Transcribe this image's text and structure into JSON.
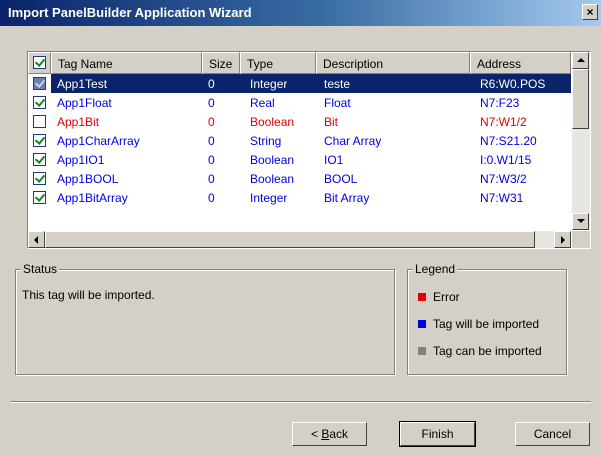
{
  "window": {
    "title": "Import PanelBuilder Application Wizard",
    "close_symbol": "×"
  },
  "table": {
    "columns": [
      "Tag Name",
      "Size",
      "Type",
      "Description",
      "Address"
    ],
    "rows": [
      {
        "checked": true,
        "name": "App1Test",
        "size": "0",
        "type": "Integer",
        "description": "teste",
        "address": "R6:W0.POS",
        "state": "selected"
      },
      {
        "checked": true,
        "name": "App1Float",
        "size": "0",
        "type": "Real",
        "description": "Float",
        "address": "N7:F23",
        "state": "import"
      },
      {
        "checked": false,
        "name": "App1Bit",
        "size": "0",
        "type": "Boolean",
        "description": "Bit",
        "address": "N7:W1/2",
        "state": "error"
      },
      {
        "checked": true,
        "name": "App1CharArray",
        "size": "0",
        "type": "String",
        "description": "Char Array",
        "address": "N7:S21.20",
        "state": "import"
      },
      {
        "checked": true,
        "name": "App1IO1",
        "size": "0",
        "type": "Boolean",
        "description": "IO1",
        "address": "I:0.W1/15",
        "state": "import"
      },
      {
        "checked": true,
        "name": "App1BOOL",
        "size": "0",
        "type": "Boolean",
        "description": "BOOL",
        "address": "N7:W3/2",
        "state": "import"
      },
      {
        "checked": true,
        "name": "App1BitArray",
        "size": "0",
        "type": "Integer",
        "description": "Bit Array",
        "address": "N7:W31",
        "state": "import"
      }
    ]
  },
  "status": {
    "label": "Status",
    "text": "This tag will be imported."
  },
  "legend": {
    "label": "Legend",
    "items": [
      {
        "text": "Error",
        "color": "#e00000"
      },
      {
        "text": "Tag will be imported",
        "color": "#0000e0"
      },
      {
        "text": "Tag can be imported",
        "color": "#808080"
      }
    ]
  },
  "buttons": {
    "back_prefix": "< ",
    "back_mnemonic": "B",
    "back_rest": "ack",
    "finish": "Finish",
    "cancel": "Cancel"
  }
}
